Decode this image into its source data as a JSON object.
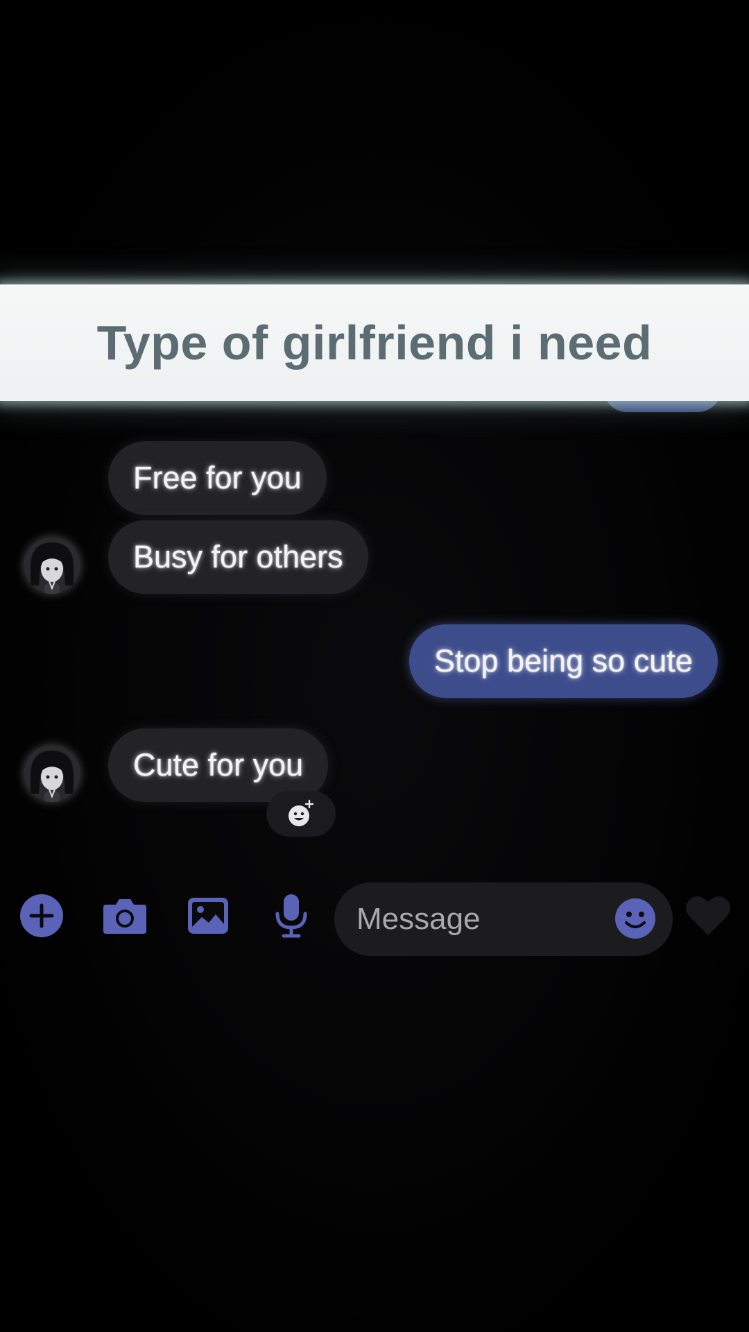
{
  "banner": {
    "title": "Type of girlfriend i need"
  },
  "messages": [
    {
      "direction": "incoming",
      "text": "Free for you"
    },
    {
      "direction": "incoming",
      "text": "Busy for others"
    },
    {
      "direction": "outgoing",
      "text": "Stop being so cute"
    },
    {
      "direction": "incoming",
      "text": "Cute for you"
    }
  ],
  "composer": {
    "placeholder": "Message",
    "icons": [
      "plus-icon",
      "camera-icon",
      "gallery-icon",
      "microphone-icon",
      "emoji-icon",
      "heart-icon"
    ]
  },
  "colors": {
    "accent": "#5a63b8",
    "outgoing_bubble": "#3d4d8c",
    "incoming_bubble": "#232325",
    "banner_text": "#5b6d72"
  }
}
